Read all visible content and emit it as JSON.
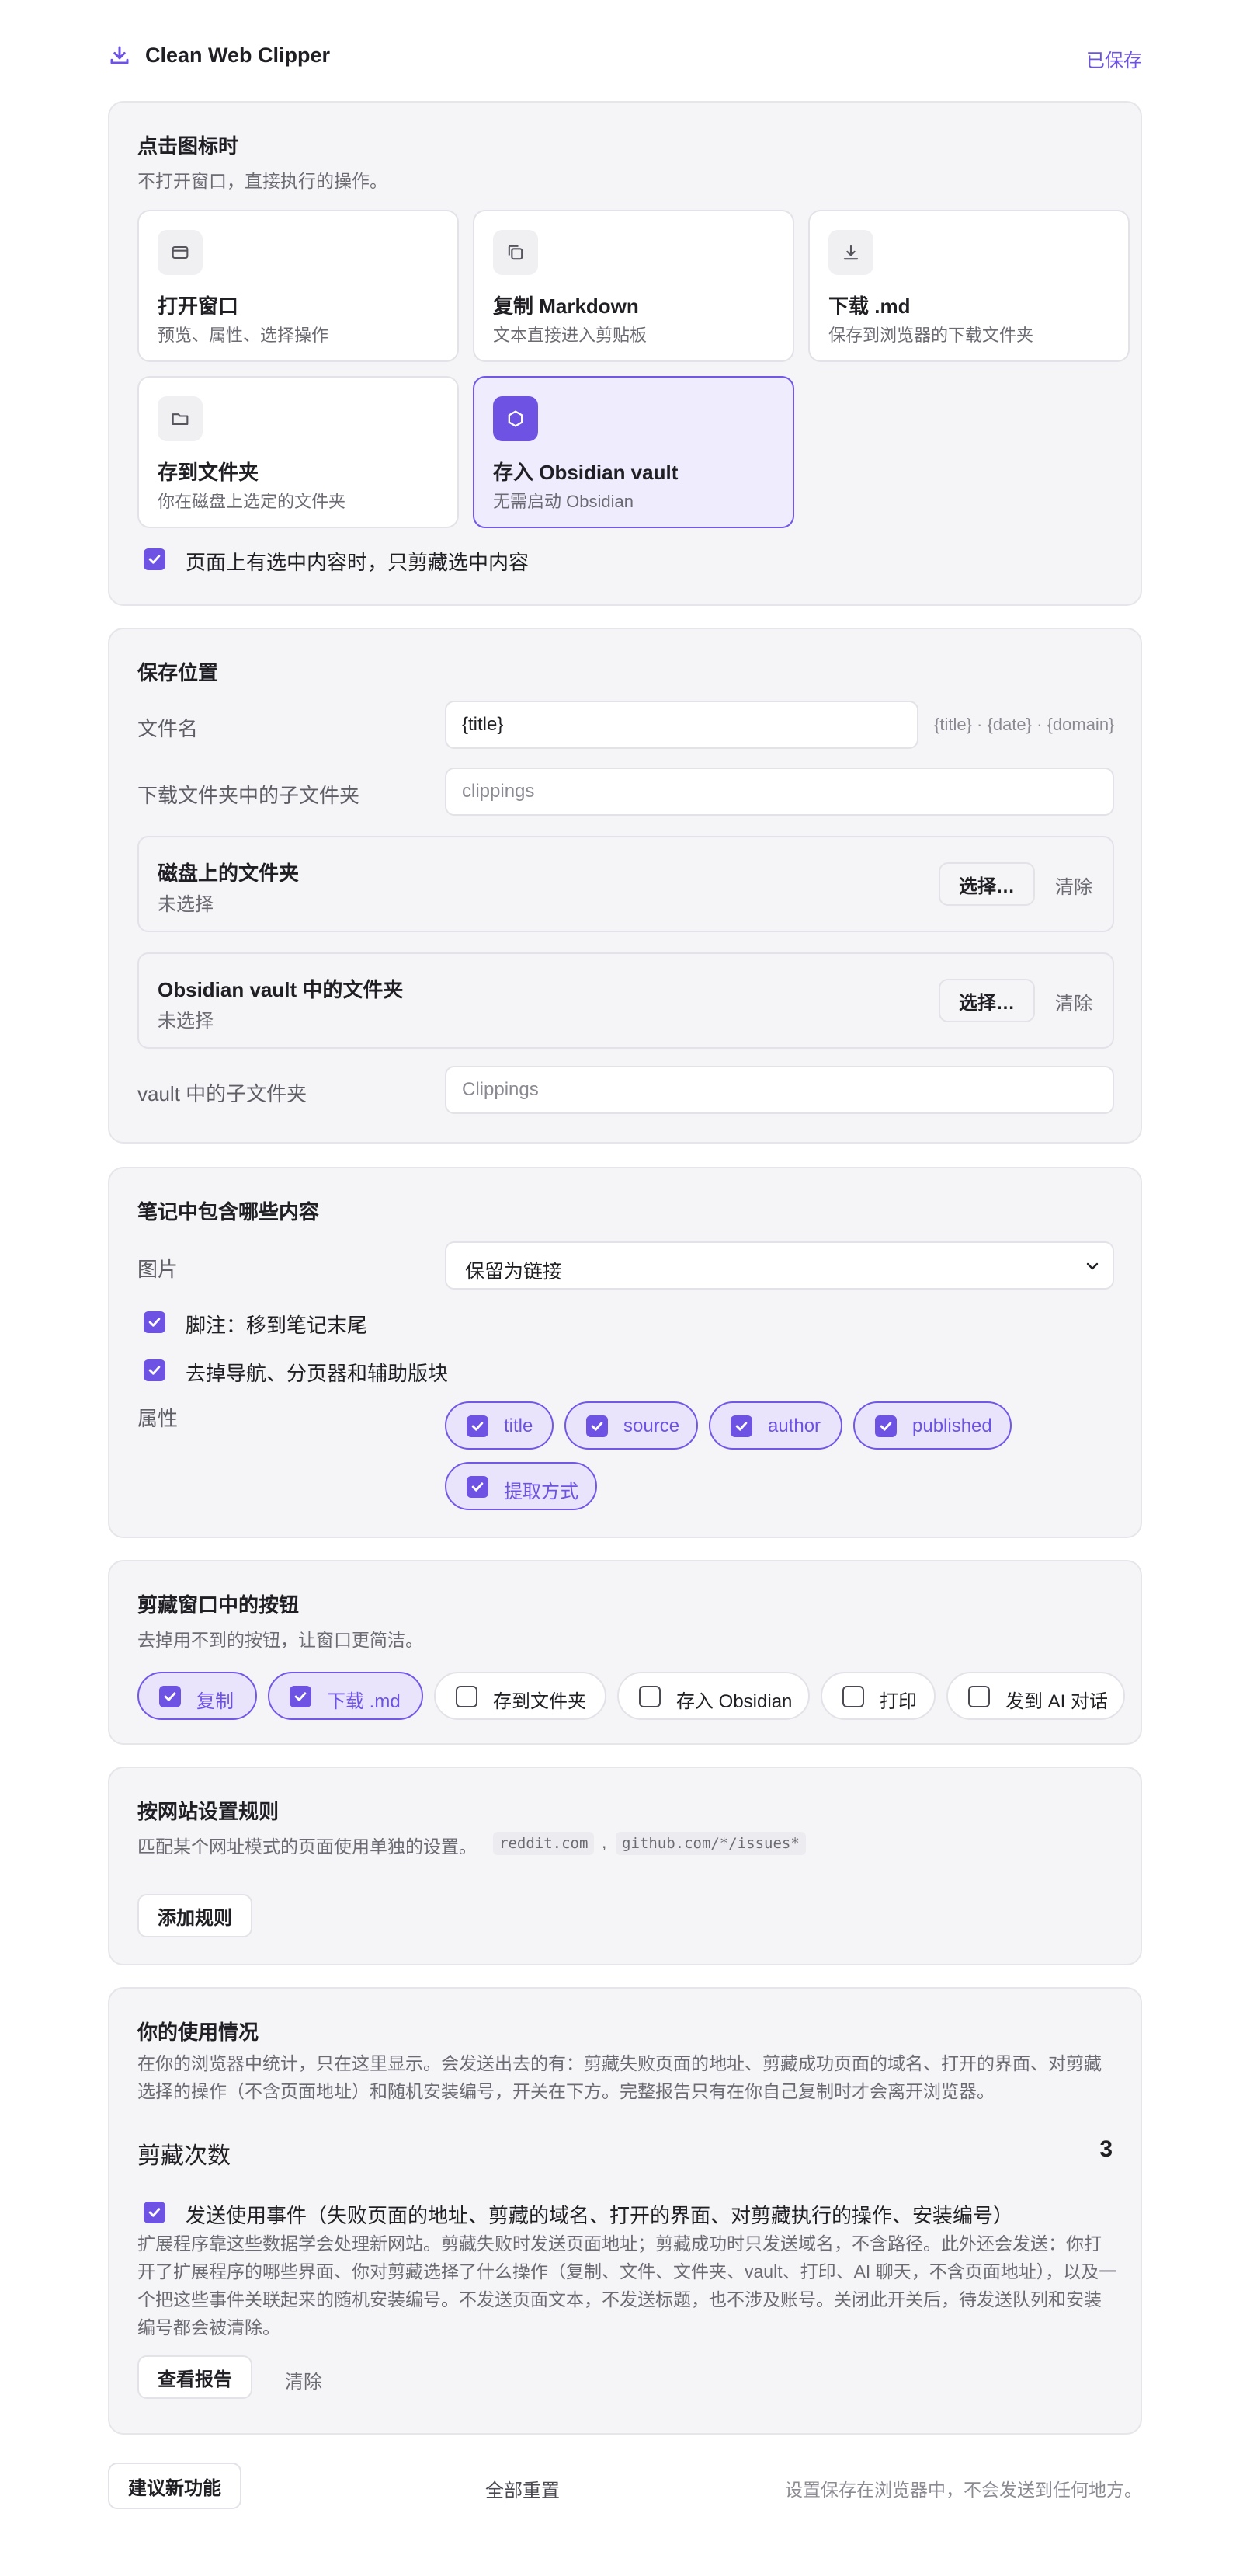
{
  "header": {
    "title": "Clean Web Clipper",
    "status": "已保存"
  },
  "click_action": {
    "title": "点击图标时",
    "desc": "不打开窗口，直接执行的操作。",
    "options": [
      {
        "title": "打开窗口",
        "desc": "预览、属性、选择操作",
        "icon": "window-icon",
        "selected": false
      },
      {
        "title": "复制 Markdown",
        "desc": "文本直接进入剪贴板",
        "icon": "copy-icon",
        "selected": false
      },
      {
        "title": "下载 .md",
        "desc": "保存到浏览器的下载文件夹",
        "icon": "download-icon",
        "selected": false
      },
      {
        "title": "存到文件夹",
        "desc": "你在磁盘上选定的文件夹",
        "icon": "folder-icon",
        "selected": false
      },
      {
        "title": "存入 Obsidian vault",
        "desc": "无需启动 Obsidian",
        "icon": "obsidian-icon",
        "selected": true
      }
    ],
    "selection_only_label": "页面上有选中内容时，只剪藏选中内容",
    "selection_only_checked": true
  },
  "save_location": {
    "title": "保存位置",
    "filename_label": "文件名",
    "filename_value": "{title}",
    "filename_hint": "{title} · {date} · {domain}",
    "download_subfolder_label": "下载文件夹中的子文件夹",
    "download_subfolder_placeholder": "clippings",
    "disk_folder": {
      "title": "磁盘上的文件夹",
      "status": "未选择",
      "choose": "选择…",
      "clear": "清除"
    },
    "vault_folder": {
      "title": "Obsidian vault 中的文件夹",
      "status": "未选择",
      "choose": "选择…",
      "clear": "清除"
    },
    "vault_subfolder_label": "vault 中的子文件夹",
    "vault_subfolder_placeholder": "Clippings"
  },
  "note_content": {
    "title": "笔记中包含哪些内容",
    "images_label": "图片",
    "images_value": "保留为链接",
    "footnotes_label": "脚注：移到笔记末尾",
    "footnotes_checked": true,
    "strip_nav_label": "去掉导航、分页器和辅助版块",
    "strip_nav_checked": true,
    "properties_label": "属性",
    "properties": [
      {
        "label": "title",
        "checked": true
      },
      {
        "label": "source",
        "checked": true
      },
      {
        "label": "author",
        "checked": true
      },
      {
        "label": "published",
        "checked": true
      },
      {
        "label": "提取方式",
        "checked": true
      }
    ]
  },
  "window_buttons": {
    "title": "剪藏窗口中的按钮",
    "desc": "去掉用不到的按钮，让窗口更简洁。",
    "items": [
      {
        "label": "复制",
        "checked": true
      },
      {
        "label": "下载 .md",
        "checked": true
      },
      {
        "label": "存到文件夹",
        "checked": false
      },
      {
        "label": "存入 Obsidian",
        "checked": false
      },
      {
        "label": "打印",
        "checked": false
      },
      {
        "label": "发到 AI 对话",
        "checked": false
      }
    ]
  },
  "site_rules": {
    "title": "按网站设置规则",
    "desc": "匹配某个网址模式的页面使用单独的设置。",
    "example1": "reddit.com",
    "separator": ",",
    "example2": "github.com/*/issues*",
    "add_button": "添加规则"
  },
  "usage": {
    "title": "你的使用情况",
    "desc": "在你的浏览器中统计，只在这里显示。会发送出去的有：剪藏失败页面的地址、剪藏成功页面的域名、打开的界面、对剪藏选择的操作（不含页面地址）和随机安装编号，开关在下方。完整报告只有在你自己复制时才会离开浏览器。",
    "count_label": "剪藏次数",
    "count_value": "3",
    "events_label": "发送使用事件（失败页面的地址、剪藏的域名、打开的界面、对剪藏执行的操作、安装编号）",
    "events_checked": true,
    "events_desc": "扩展程序靠这些数据学会处理新网站。剪藏失败时发送页面地址；剪藏成功时只发送域名，不含路径。此外还会发送：你打开了扩展程序的哪些界面、你对剪藏选择了什么操作（复制、文件、文件夹、vault、打印、AI 聊天，不含页面地址），以及一个把这些事件关联起来的随机安装编号。不发送页面文本，不发送标题，也不涉及账号。关闭此开关后，待发送队列和安装编号都会被清除。",
    "view_report": "查看报告",
    "clear": "清除"
  },
  "footer": {
    "suggest": "建议新功能",
    "reset_all": "全部重置",
    "note": "设置保存在浏览器中，不会发送到任何地方。"
  },
  "colors": {
    "accent": "#6e52e3",
    "card_bg": "#f5f5f7",
    "selected_bg": "#efecfd"
  }
}
